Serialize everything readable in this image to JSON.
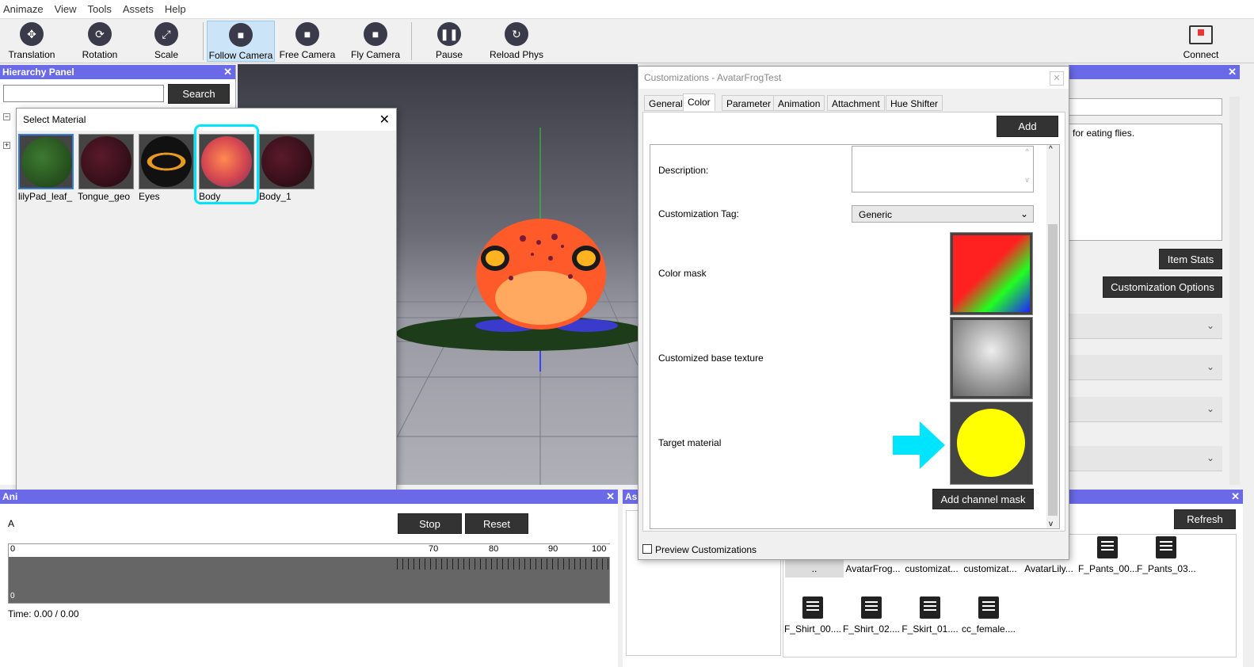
{
  "menu": [
    "Animaze",
    "View",
    "Tools",
    "Assets",
    "Help"
  ],
  "toolbar": {
    "buttons": [
      {
        "label": "Translation",
        "icon": "translation-icon"
      },
      {
        "label": "Rotation",
        "icon": "rotation-icon"
      },
      {
        "label": "Scale",
        "icon": "scale-icon"
      },
      {
        "label": "Follow Camera",
        "icon": "camera-icon"
      },
      {
        "label": "Free Camera",
        "icon": "camera-icon"
      },
      {
        "label": "Fly Camera",
        "icon": "camera-icon"
      },
      {
        "label": "Pause",
        "icon": "pause-icon"
      },
      {
        "label": "Reload Phys",
        "icon": "reload-icon"
      }
    ],
    "connect_label": "Connect"
  },
  "hierarchy": {
    "title": "Hierarchy Panel",
    "search_label": "Search",
    "search_value": ""
  },
  "select_material": {
    "title": "Select Material",
    "materials": [
      {
        "label": "lilyPad_leaf_"
      },
      {
        "label": "Tongue_geo"
      },
      {
        "label": "Eyes"
      },
      {
        "label": "Body"
      },
      {
        "label": "Body_1"
      }
    ]
  },
  "animation": {
    "title_partial": "Ani",
    "label_partial": "A",
    "stop_label": "Stop",
    "reset_label": "Reset",
    "ticks": [
      "70",
      "80",
      "90",
      "100"
    ],
    "start_tick": "0",
    "time_text": "Time: 0.00 / 0.00"
  },
  "customizations": {
    "title": "Customizations - AvatarFrogTest",
    "tabs": [
      "General",
      "Color",
      "Parameter",
      "Animation",
      "Attachment",
      "Hue Shifter"
    ],
    "add_label": "Add",
    "description_label": "Description:",
    "description_value": "",
    "tag_label": "Customization Tag:",
    "tag_value": "Generic",
    "color_mask_label": "Color mask",
    "base_texture_label": "Customized base texture",
    "target_material_label": "Target material",
    "add_channel_mask_label": "Add channel mask",
    "preview_label": "Preview Customizations"
  },
  "right_panel": {
    "description_partial": "for eating flies.",
    "item_stats_label": "Item Stats",
    "customization_options_label": "Customization Options"
  },
  "assets": {
    "title_partial": "As",
    "refresh_label": "Refresh",
    "items": [
      {
        "label": ".."
      },
      {
        "label": "AvatarFrog..."
      },
      {
        "label": "customizat..."
      },
      {
        "label": "customizat..."
      },
      {
        "label": "AvatarLily..."
      },
      {
        "label": "F_Pants_00..."
      },
      {
        "label": "F_Pants_03..."
      },
      {
        "label": "F_Shirt_00...."
      },
      {
        "label": "F_Shirt_02...."
      },
      {
        "label": "F_Skirt_01...."
      },
      {
        "label": "cc_female...."
      }
    ]
  },
  "colors": {
    "panel_title_bg": "#6a6ae8",
    "highlight_cyan": "#00e5ff",
    "target_yellow": "#ffff00"
  }
}
